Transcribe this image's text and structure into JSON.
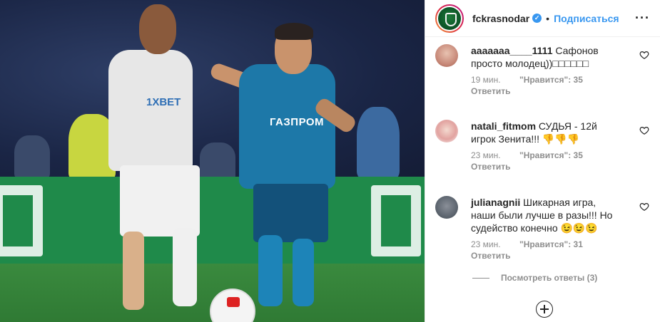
{
  "header": {
    "username": "fckrasnodar",
    "separator": "•",
    "follow_label": "Подписаться",
    "more_label": "···"
  },
  "photo": {
    "white_sponsor": "1XBET",
    "blue_sponsor": "ГАЗПРОМ"
  },
  "comments": [
    {
      "username": "aaaaaaa____1111",
      "text": "Сафонов просто молодец))□□□□□□",
      "time": "19 мин.",
      "likes": "\"Нравится\": 35",
      "reply": "Ответить"
    },
    {
      "username": "natali_fitmom",
      "text": "СУДЬЯ - 12й игрок Зенита!!! 👎👎👎",
      "time": "23 мин.",
      "likes": "\"Нравится\": 35",
      "reply": "Ответить"
    },
    {
      "username": "julianagnii",
      "text": "Шикарная игра, наши были лучше в разы!!! Но судейство конечно 😉😉😉",
      "time": "23 мин.",
      "likes": "\"Нравится\": 31",
      "reply": "Ответить"
    }
  ],
  "view_replies_label": "Посмотреть ответы (3)",
  "colors": {
    "accent": "#3897f0",
    "muted": "#8e8e8e",
    "text": "#262626"
  }
}
